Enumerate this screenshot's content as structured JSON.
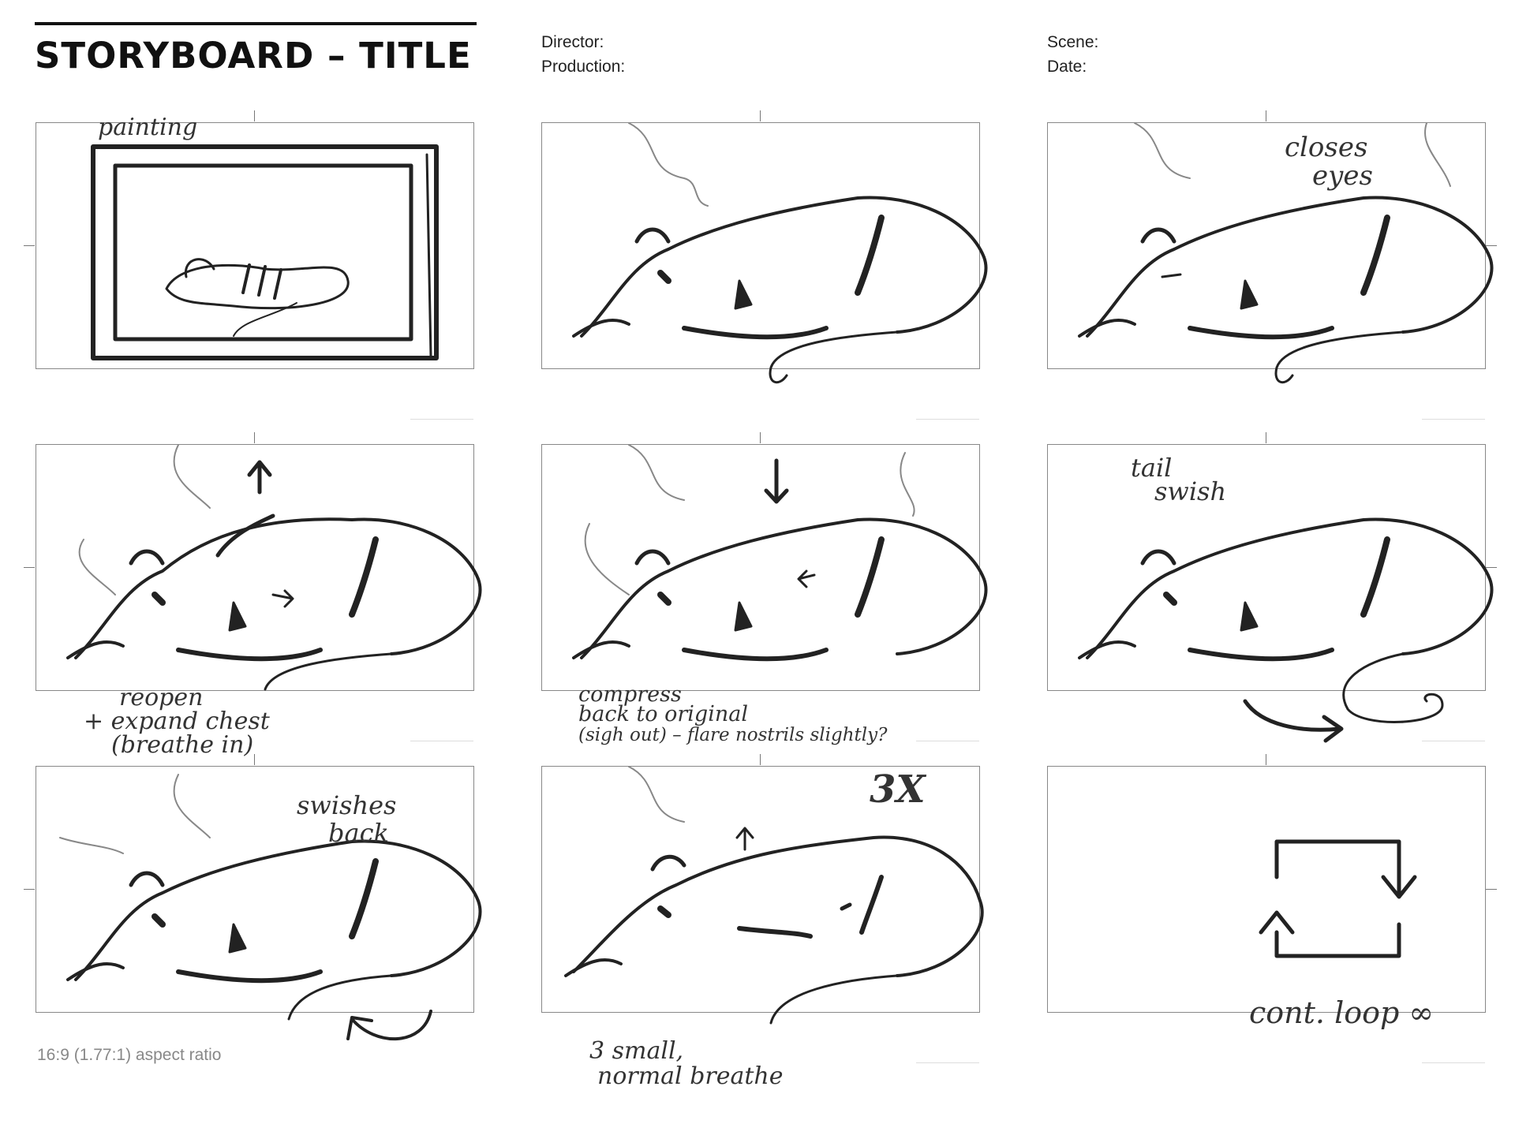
{
  "header": {
    "title": "STORYBOARD – TITLE",
    "director_label": "Director:",
    "production_label": "Production:",
    "scene_label": "Scene:",
    "date_label": "Date:"
  },
  "footer": {
    "aspect_ratio": "16:9 (1.77:1) aspect ratio"
  },
  "panels": [
    {
      "notes": [
        "painting"
      ]
    },
    {
      "notes": []
    },
    {
      "notes": [
        "closes",
        "eyes"
      ]
    },
    {
      "notes": [
        "reopen",
        "+ expand chest",
        "(breathe in)"
      ]
    },
    {
      "notes": [
        "compress",
        "back to original",
        "(sigh out) – flare nostrils slightly?"
      ]
    },
    {
      "notes": [
        "tail",
        "swish"
      ]
    },
    {
      "notes": [
        "swishes",
        "back"
      ]
    },
    {
      "notes": [
        "3X",
        "3 small,",
        "normal breathe"
      ]
    },
    {
      "notes": [
        "cont. loop ∞"
      ]
    }
  ]
}
